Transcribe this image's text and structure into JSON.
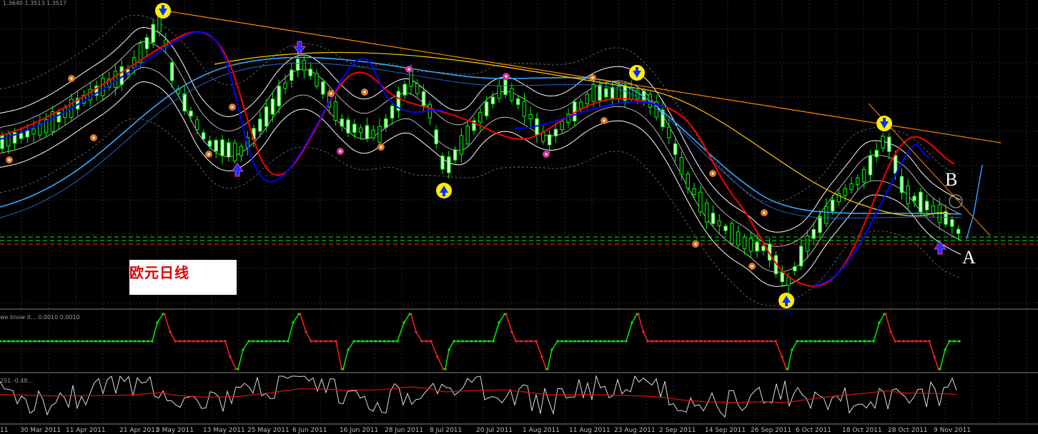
{
  "main_panel": {
    "header": "1.3640 1.3513 1.3517",
    "annotation_box": "欧元日线",
    "point_labels": {
      "a": "A",
      "b": "B"
    },
    "colors": {
      "bull": "#ccffcc",
      "bear": "#00ff00",
      "ma_fast": "#0000ff",
      "ma_slow": "#ff0000",
      "trend": "#ff8800",
      "band": "#ffffff"
    }
  },
  "indicator_1": {
    "header": "we know it... 0.0010 0.0010"
  },
  "indicator_2": {
    "header": "2S1 -0.48..."
  },
  "x_axis": {
    "labels": [
      "11",
      "30 Mar 2011",
      "11 Apr 2011",
      "21 Apr 2011",
      "3 May 2011",
      "13 May 2011",
      "25 May 2011",
      "6 Jun 2011",
      "16 Jun 2011",
      "28 Jun 2011",
      "8 Jul 2011",
      "20 Jul 2011",
      "1 Aug 2011",
      "11 Aug 2011",
      "23 Aug 2011",
      "2 Sep 2011",
      "14 Sep 2011",
      "26 Sep 2011",
      "6 Oct 2011",
      "18 Oct 2011",
      "28 Oct 2011",
      "9 Nov 2011"
    ]
  }
}
